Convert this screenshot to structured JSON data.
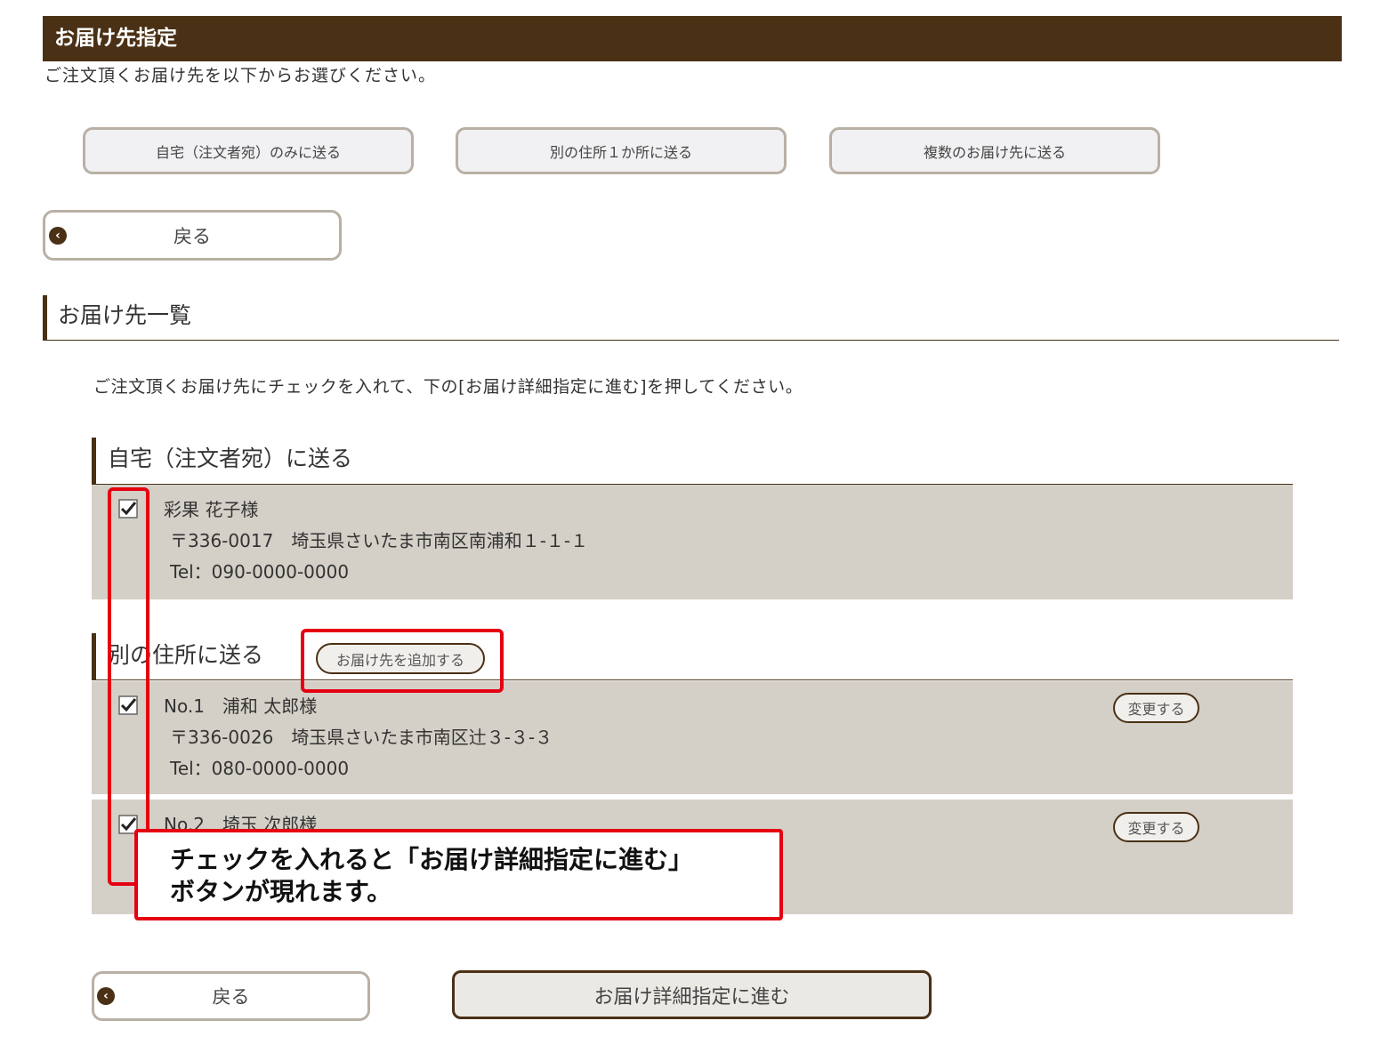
{
  "header": {
    "title": "お届け先指定"
  },
  "intro": "ご注文頂くお届け先を以下からお選びください。",
  "options": [
    {
      "label": "自宅（注文者宛）のみに送る"
    },
    {
      "label": "別の住所１か所に送る"
    },
    {
      "label": "複数のお届け先に送る"
    }
  ],
  "back_label": "戻る",
  "list": {
    "title": "お届け先一覧",
    "instruction": "ご注文頂くお届け先にチェックを入れて、下の[お届け詳細指定に進む]を押してください。"
  },
  "home": {
    "title": "自宅（注文者宛）に送る",
    "name": "彩果 花子様",
    "address": "〒336-0017　埼玉県さいたま市南区南浦和１-１-１",
    "tel": "Tel：090-0000-0000",
    "checked": true
  },
  "other": {
    "title": "別の住所に送る",
    "add_label": "お届け先を追加する",
    "entries": [
      {
        "name": "No.1　浦和 太郎様",
        "address": "〒336-0026　埼玉県さいたま市南区辻３-３-３",
        "tel": "Tel：080-0000-0000",
        "change_label": "変更する",
        "checked": true
      },
      {
        "name": "No.2　埼玉 次郎様",
        "change_label": "変更する",
        "checked": true
      }
    ]
  },
  "callout": {
    "line1": "チェックを入れると「お届け詳細指定に進む」",
    "line2": "ボタンが現れます。"
  },
  "footer": {
    "back_label": "戻る",
    "proceed_label": "お届け詳細指定に進む"
  },
  "colors": {
    "brand": "#4a3015",
    "panel": "#d4d0c8",
    "annotation": "#e50012"
  }
}
